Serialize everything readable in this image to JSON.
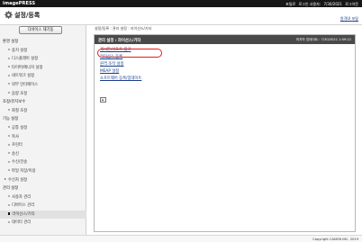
{
  "topbar": {
    "brand": "imagePRESS",
    "right_texts": [
      "포털로",
      "로그인 사용자:",
      "7/30/2021",
      "로그아웃"
    ]
  },
  "title": {
    "text": "설정/등록",
    "portal_link": "원격UI 포털"
  },
  "sidebar": {
    "device_button": "디바이스 재기동",
    "items": [
      {
        "type": "header",
        "label": "환경 설정"
      },
      {
        "type": "item",
        "label": "용지 설정"
      },
      {
        "type": "item",
        "label": "디스플레이 설정"
      },
      {
        "type": "item",
        "label": "타이머/에너지 설정"
      },
      {
        "type": "item",
        "label": "네트워크 설정"
      },
      {
        "type": "item",
        "label": "외부 인터페이스"
      },
      {
        "type": "item",
        "label": "음량 조정"
      },
      {
        "type": "header",
        "label": "조정/유지보수"
      },
      {
        "type": "item",
        "label": "화질 조정"
      },
      {
        "type": "header",
        "label": "기능 설정"
      },
      {
        "type": "item",
        "label": "공통 설정"
      },
      {
        "type": "item",
        "label": "복사"
      },
      {
        "type": "item",
        "label": "프린터"
      },
      {
        "type": "item",
        "label": "송신"
      },
      {
        "type": "item",
        "label": "수신/전송"
      },
      {
        "type": "item",
        "label": "파일 저장/이용"
      },
      {
        "type": "arrow",
        "label": "수신처 설정"
      },
      {
        "type": "header",
        "label": "관리 설정"
      },
      {
        "type": "item",
        "label": "사용자 관리"
      },
      {
        "type": "item",
        "label": "디바이스 관리"
      },
      {
        "type": "item",
        "label": "라이선스/기타",
        "active": true
      },
      {
        "type": "item",
        "label": "데이터 관리"
      }
    ]
  },
  "main": {
    "breadcrumb": "설정/등록 : 관리 설정 : 라이선스/기타",
    "panel_title": "관리 설정 : 라이선스/기타",
    "panel_time": "마지막 업데이트 : 7/30/2021 1:09:22",
    "links": [
      "게시판/서포트 링크",
      "라이선스 등록",
      "원격 조작 설정",
      "MEAP 설정",
      "소프트웨어 등록/업데이트"
    ]
  },
  "footer": {
    "copyright": "Copyright CANON INC. 2019"
  },
  "colors": {
    "topbar": "#171717",
    "panel_header": "#494949",
    "link": "#1a3e8c",
    "highlight": "#e41b1b",
    "sidebar_bg": "#f3f3f3"
  }
}
